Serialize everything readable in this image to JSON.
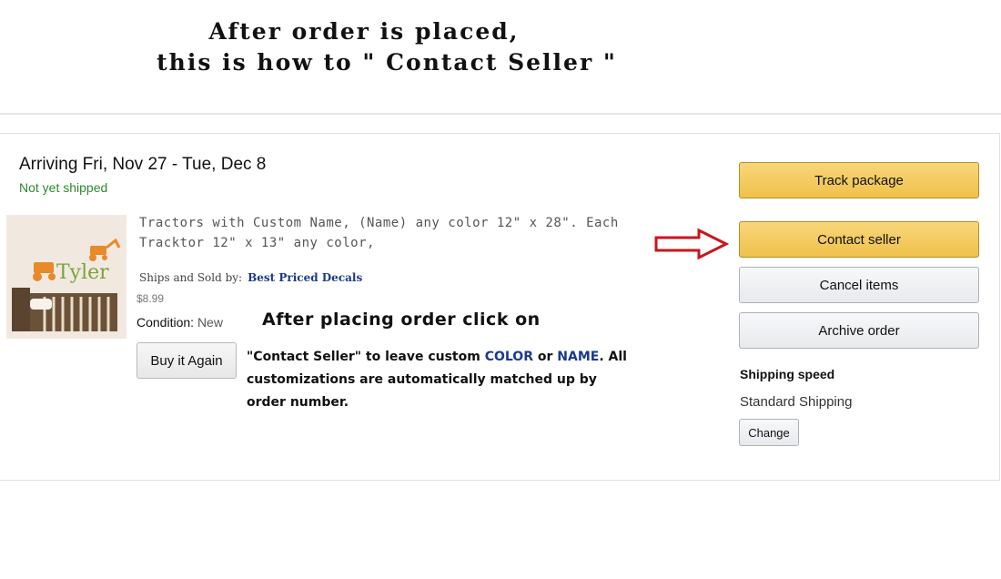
{
  "heading": {
    "line1": "After order is placed,",
    "line2": "this is how to \" Contact Seller \""
  },
  "order": {
    "arriving": "Arriving Fri, Nov 27 - Tue, Dec 8",
    "status": "Not yet shipped",
    "status_color": "#2b8a2b",
    "product_image_text": "Tyler",
    "product_title": "Tractors with Custom Name, (Name) any color 12\" x 28\". Each Tracktor 12\" x 13\" any color,",
    "ships_sold_label": "Ships and Sold by:",
    "seller_name": "Best Priced Decals",
    "price": "$8.99",
    "condition_label": "Condition:",
    "condition_value": "New",
    "buy_again_label": "Buy it Again"
  },
  "instructions": {
    "line1": "After placing order click on",
    "part1": "\"Contact Seller\" to leave custom ",
    "kw1": "COLOR",
    "part2": " or ",
    "kw2": "NAME",
    "part3": ". All customizations are automatically matched up by order number."
  },
  "actions": {
    "track_package": "Track package",
    "contact_seller": "Contact seller",
    "cancel_items": "Cancel items",
    "archive_order": "Archive order"
  },
  "shipping": {
    "label": "Shipping speed",
    "value": "Standard Shipping",
    "change_label": "Change"
  },
  "colors": {
    "primary_button": "#f0c14b",
    "secondary_button": "#e7e9ec",
    "arrow": "#c8161d",
    "keyword": "#1a3a8a"
  }
}
